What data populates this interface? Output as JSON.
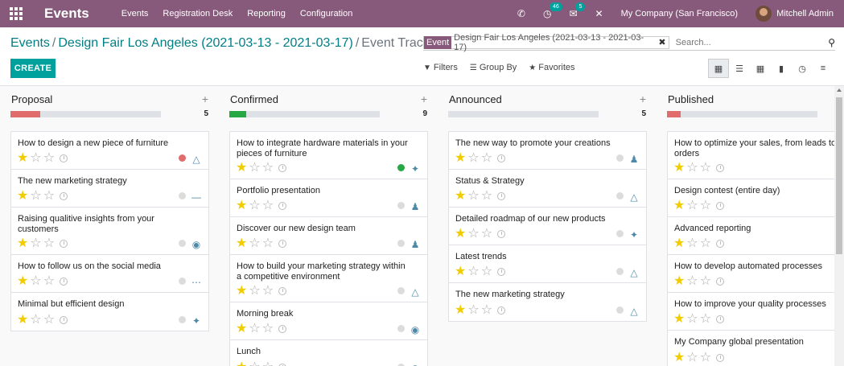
{
  "nav": {
    "app_name": "Events",
    "menu": [
      "Events",
      "Registration Desk",
      "Reporting",
      "Configuration"
    ],
    "activity_badge": "46",
    "messages_badge": "5",
    "company": "My Company (San Francisco)",
    "user": "Mitchell Admin"
  },
  "breadcrumb": {
    "root": "Events",
    "middle": "Design Fair Los Angeles (2021-03-13 - 2021-03-17)",
    "current": "Event Tracks"
  },
  "search": {
    "facet_label": "Event",
    "facet_value": "Design Fair Los Angeles (2021-03-13 - 2021-03-17)",
    "placeholder": "Search..."
  },
  "toolbar": {
    "create_label": "CREATE",
    "filters_label": "Filters",
    "group_by_label": "Group By",
    "favorites_label": "Favorites"
  },
  "colors": {
    "brand": "#875a7b",
    "accent": "#00a09d",
    "red": "#e06c6c",
    "green": "#28a745"
  },
  "columns": [
    {
      "title": "Proposal",
      "count": "5",
      "progress_color": "#e06c6c",
      "progress_fraction": 0.2,
      "cards": [
        {
          "title": "How to design a new piece of furniture",
          "status": "red",
          "logo": "tree-logo"
        },
        {
          "title": "The new marketing strategy",
          "status": "grey",
          "logo": "line-logo"
        },
        {
          "title": "Raising qualitive insights from your customers",
          "status": "grey",
          "logo": "camera-logo"
        },
        {
          "title": "How to follow us on the social media",
          "status": "grey",
          "logo": "dots-logo"
        },
        {
          "title": "Minimal but efficient design",
          "status": "grey",
          "logo": "bird-logo"
        }
      ]
    },
    {
      "title": "Confirmed",
      "count": "9",
      "progress_color": "#28a745",
      "progress_fraction": 0.11,
      "cards": [
        {
          "title": "How to integrate hardware materials in your pieces of furniture",
          "status": "green",
          "logo": "bird-logo"
        },
        {
          "title": "Portfolio presentation",
          "status": "grey",
          "logo": "people-logo"
        },
        {
          "title": "Discover our new design team",
          "status": "grey",
          "logo": "people-logo"
        },
        {
          "title": "How to build your marketing strategy within a competitive environment",
          "status": "grey",
          "logo": "tree-logo"
        },
        {
          "title": "Morning break",
          "status": "grey",
          "logo": "camera-logo"
        },
        {
          "title": "Lunch",
          "status": "grey",
          "logo": "camera-logo"
        }
      ]
    },
    {
      "title": "Announced",
      "count": "5",
      "progress_color": "#dee2e6",
      "progress_fraction": 0,
      "cards": [
        {
          "title": "The new way to promote your creations",
          "status": "grey",
          "logo": "people-logo"
        },
        {
          "title": "Status & Strategy",
          "status": "grey",
          "logo": "tree-logo"
        },
        {
          "title": "Detailed roadmap of our new products",
          "status": "grey",
          "logo": "bird-logo"
        },
        {
          "title": "Latest trends",
          "status": "grey",
          "logo": "tree-logo"
        },
        {
          "title": "The new marketing strategy",
          "status": "grey",
          "logo": "tree-logo"
        }
      ]
    },
    {
      "title": "Published",
      "count": "",
      "progress_color": "#e06c6c",
      "progress_fraction": 0.09,
      "cards": [
        {
          "title": "How to optimize your sales, from leads to orders"
        },
        {
          "title": "Design contest (entire day)"
        },
        {
          "title": "Advanced reporting"
        },
        {
          "title": "How to develop automated processes"
        },
        {
          "title": "How to improve your quality processes"
        },
        {
          "title": "My Company global presentation"
        }
      ]
    }
  ]
}
